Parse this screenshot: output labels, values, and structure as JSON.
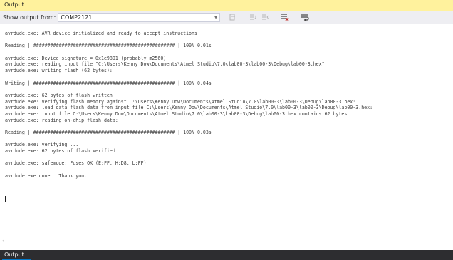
{
  "panel": {
    "title": "Output",
    "show_output_label": "Show output from:",
    "source_value": "COMP2121",
    "icons": [
      "go-to-previous-icon",
      "go-to-next-icon",
      "find-message-icon",
      "clear-all-icon",
      "word-wrap-icon"
    ]
  },
  "log": {
    "lines": [
      "avrdude.exe: AVR device initialized and ready to accept instructions",
      "",
      "Reading | ################################################## | 100% 0.01s",
      "",
      "avrdude.exe: Device signature = 0x1e9801 (probably m2560)",
      "avrdude.exe: reading input file \"C:\\Users\\Kenny Dow\\Documents\\Atmel Studio\\7.0\\lab00-3\\lab00-3\\Debug\\lab00-3.hex\"",
      "avrdude.exe: writing flash (62 bytes):",
      "",
      "Writing | ################################################## | 100% 0.04s",
      "",
      "avrdude.exe: 62 bytes of flash written",
      "avrdude.exe: verifying flash memory against C:\\Users\\Kenny Dow\\Documents\\Atmel Studio\\7.0\\lab00-3\\lab00-3\\Debug\\lab00-3.hex:",
      "avrdude.exe: load data flash data from input file C:\\Users\\Kenny Dow\\Documents\\Atmel Studio\\7.0\\lab00-3\\lab00-3\\Debug\\lab00-3.hex:",
      "avrdude.exe: input file C:\\Users\\Kenny Dow\\Documents\\Atmel Studio\\7.0\\lab00-3\\lab00-3\\Debug\\lab00-3.hex contains 62 bytes",
      "avrdude.exe: reading on-chip flash data:",
      "",
      "Reading | ################################################## | 100% 0.03s",
      "",
      "avrdude.exe: verifying ...",
      "avrdude.exe: 62 bytes of flash verified",
      "",
      "avrdude.exe: safemode: Fuses OK (E:FF, H:D8, L:FF)",
      "",
      "avrdude.exe done.  Thank you.",
      ""
    ]
  },
  "status_bar": {
    "tab_label": "Output"
  },
  "colors": {
    "title_bar_bg": "#fff29d",
    "toolbar_bg": "#eeeef2",
    "status_bar_bg": "#2d2d30",
    "accent": "#007acc",
    "log_text": "#3c3c3c"
  }
}
